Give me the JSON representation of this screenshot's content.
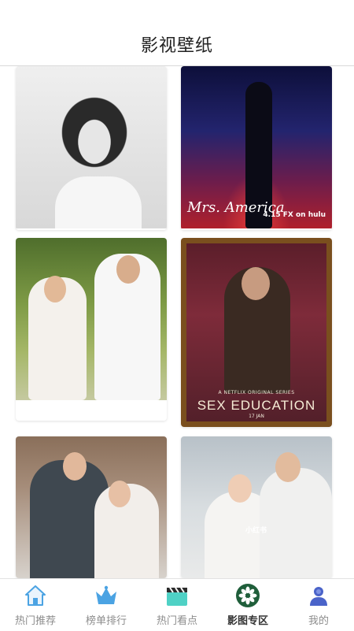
{
  "header": {
    "title": "影视壁纸"
  },
  "posters": {
    "mrs_america": {
      "title": "Mrs. America",
      "date": "4.15 FX on hulu"
    },
    "sex_education": {
      "subtitle": "A NETFLIX ORIGINAL SERIES",
      "title": "SEX EDUCATION",
      "date": "17 JAN"
    }
  },
  "watermark": "小红书",
  "tabbar": {
    "tabs": [
      {
        "label": "热门推荐",
        "icon": "house-icon",
        "active": false
      },
      {
        "label": "榜单排行",
        "icon": "crown-icon",
        "active": false
      },
      {
        "label": "热门看点",
        "icon": "clapperboard-icon",
        "active": false
      },
      {
        "label": "影图专区",
        "icon": "flower-icon",
        "active": true
      },
      {
        "label": "我的",
        "icon": "user-icon",
        "active": false
      }
    ]
  },
  "colors": {
    "tab_active": "#333333",
    "tab_inactive": "#8c8c8c",
    "icon_blue": "#4ba3e3",
    "icon_teal": "#4fd1c5",
    "icon_green": "#1f5e3a"
  }
}
